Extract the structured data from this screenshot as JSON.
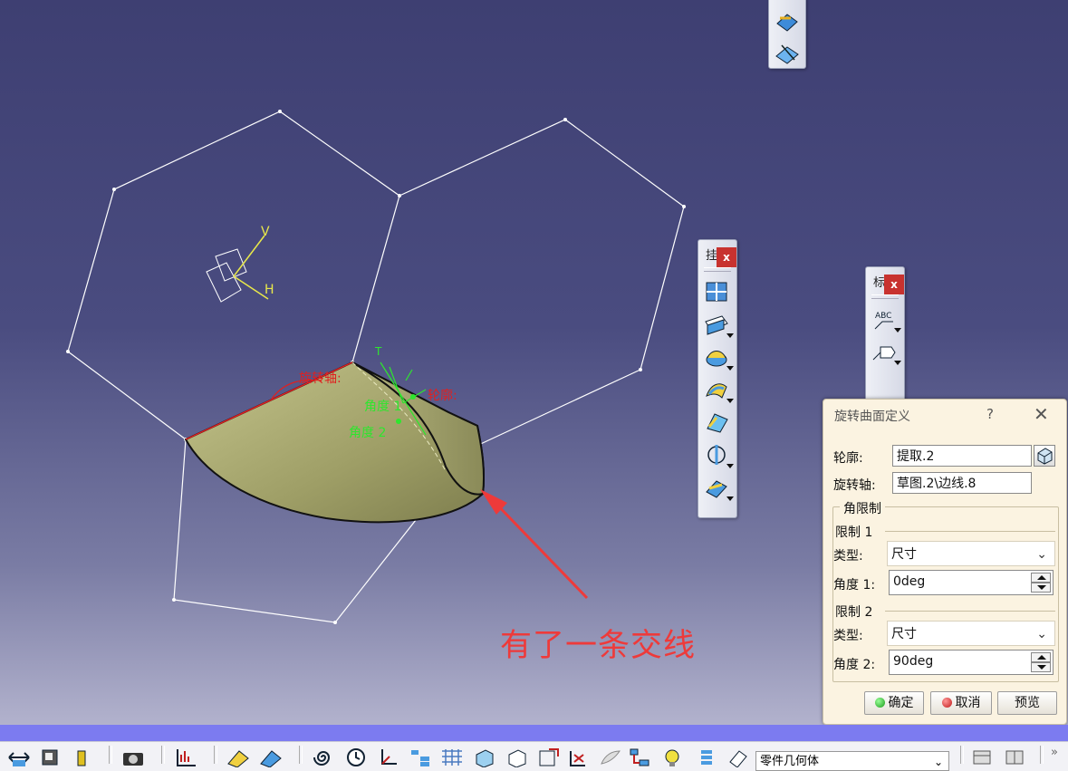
{
  "viewport": {
    "h_label": "H",
    "v_label": "V",
    "axis_label": "旋转轴:",
    "profile_label": "轮廓:",
    "angle1_label": "角度 1",
    "angle2_label": "角度 2",
    "t_label": "T",
    "annotation": "有了一条交线"
  },
  "toolbar_right": {
    "title": "挂",
    "close": "x"
  },
  "toolbar_right2": {
    "title": "标",
    "close": "x"
  },
  "dialog": {
    "title": "旋转曲面定义",
    "help": "?",
    "close": "✕",
    "profile_label": "轮廓:",
    "profile_value": "提取.2",
    "axis_label": "旋转轴:",
    "axis_value": "草图.2\\边线.8",
    "angle_limits": "角限制",
    "limit1": "限制 1",
    "type1_label": "类型:",
    "type1_value": "尺寸",
    "angle1_label": "角度 1:",
    "angle1_value": "0deg",
    "limit2": "限制 2",
    "type2_label": "类型:",
    "type2_value": "尺寸",
    "angle2_label": "角度 2:",
    "angle2_value": "90deg",
    "ok": "确定",
    "cancel": "取消",
    "preview": "预览"
  },
  "bottombar": {
    "body_select": "零件几何体",
    "more": "»"
  },
  "colors": {
    "viewport_top": "#3e3f72",
    "surface": "#a8a872",
    "annotation": "#ee3a3a",
    "highlight_green": "#2ee62e",
    "axis_red": "#e02020"
  }
}
